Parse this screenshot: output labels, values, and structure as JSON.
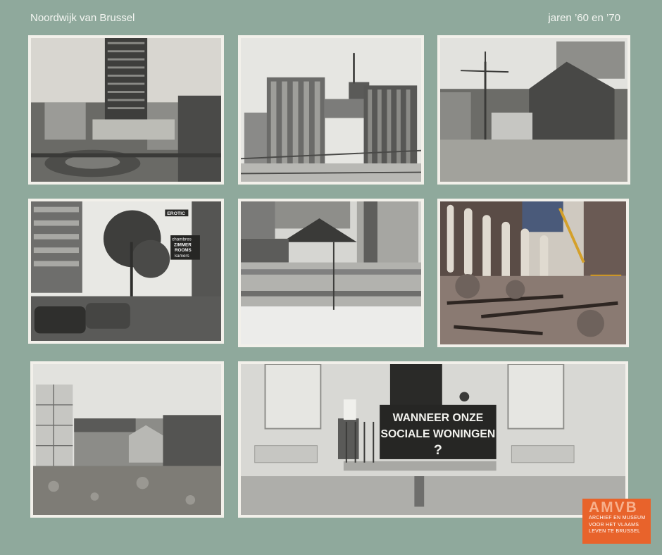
{
  "header": {
    "title": "Noordwijk van Brussel",
    "period": "jaren ’60 en ’70"
  },
  "photos": [
    {
      "name": "photo-tower-square",
      "caption": ""
    },
    {
      "name": "photo-office-towers",
      "caption": ""
    },
    {
      "name": "photo-wind-turbine-church",
      "caption": ""
    },
    {
      "name": "photo-street-signs",
      "caption": "",
      "signs": [
        "EROTIC",
        "chambres",
        "ZIMMER",
        "ROOMS",
        "kamers"
      ]
    },
    {
      "name": "photo-wall-mural",
      "caption": ""
    },
    {
      "name": "photo-church-demolition",
      "caption": ""
    },
    {
      "name": "photo-empty-lot",
      "caption": ""
    },
    {
      "name": "photo-protest-banner",
      "caption": "",
      "banner_line1": "WANNEER ONZE",
      "banner_line2": "SOCIALE WONINGEN",
      "banner_line3": "?"
    }
  ],
  "logo": {
    "mark": "AMVB",
    "lines": [
      "ARCHIEF EN MUSEUM",
      "VOOR HET VLAAMS",
      "LEVEN TE BRUSSEL"
    ],
    "color": "#e8632b"
  },
  "colors": {
    "background": "#8fa99c",
    "frame": "#f2f0ea"
  }
}
